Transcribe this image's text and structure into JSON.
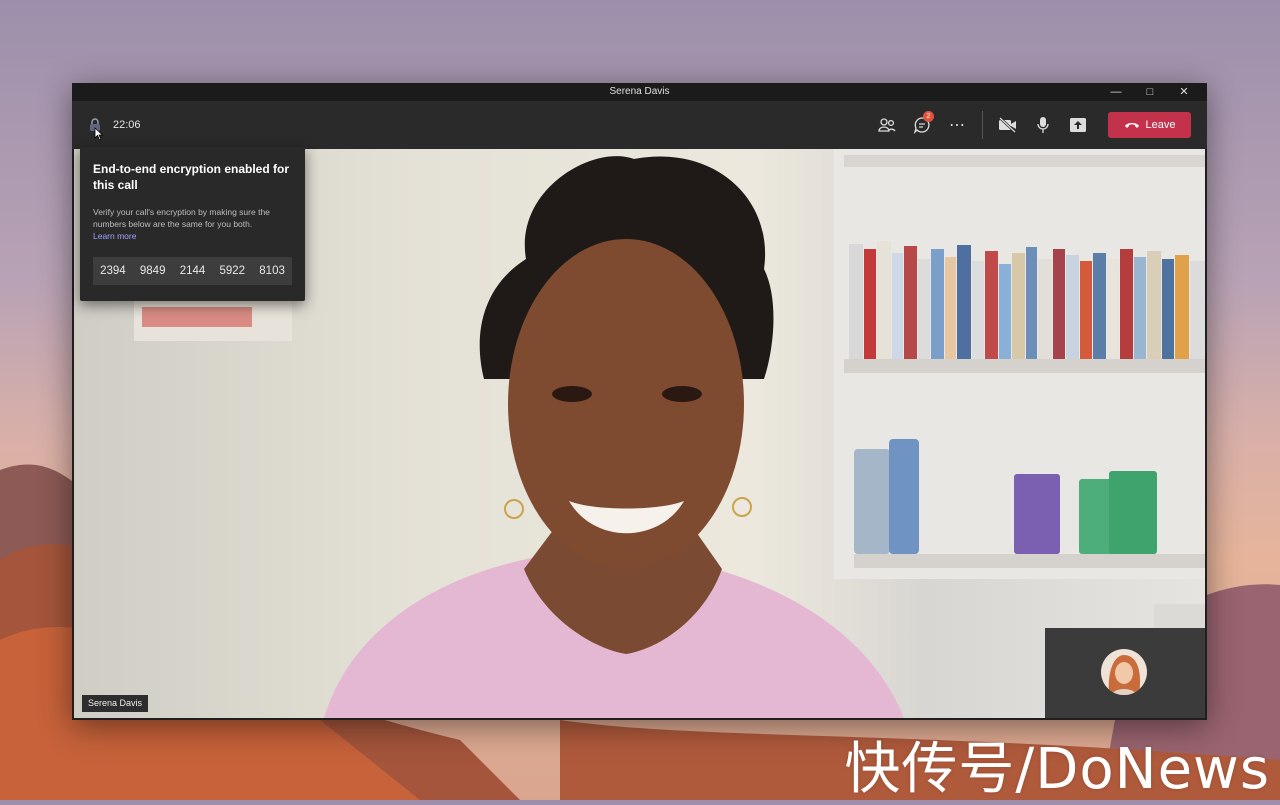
{
  "window": {
    "title": "Serena Davis",
    "controls": [
      "minimize-icon",
      "maximize-icon",
      "close-icon"
    ]
  },
  "toolbar": {
    "timer": "22:06",
    "chat_badge": "2",
    "leave_label": "Leave",
    "leave_color": "#c4314b"
  },
  "encryption": {
    "title": "End-to-end encryption enabled for this call",
    "description": "Verify your call's encryption by making sure the numbers below are the same for you both.",
    "link": "Learn more",
    "codes": [
      "2394",
      "9849",
      "2144",
      "5922",
      "8103"
    ]
  },
  "video": {
    "participant_name": "Serena Davis"
  },
  "watermark": "快传号/DoNews"
}
